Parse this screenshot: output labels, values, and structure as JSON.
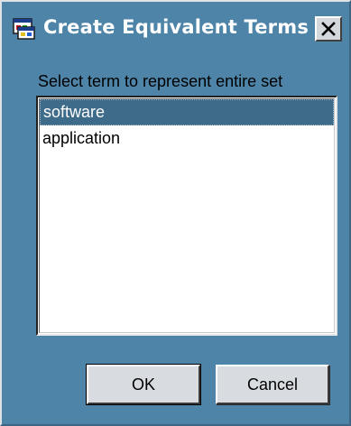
{
  "window": {
    "title": "Create Equivalent Terms",
    "close_symbol": "✕"
  },
  "icons": {
    "app": "dialog-app-icon",
    "close": "close-icon"
  },
  "colors": {
    "dialog_background": "#4e84a8",
    "selection": "#3f6b8a",
    "button_face": "#d8dce0"
  },
  "instruction": "Select term to represent entire set",
  "terms": {
    "items": [
      "software",
      "application"
    ],
    "selected": "software"
  },
  "buttons": {
    "ok_label": "OK",
    "cancel_label": "Cancel"
  }
}
